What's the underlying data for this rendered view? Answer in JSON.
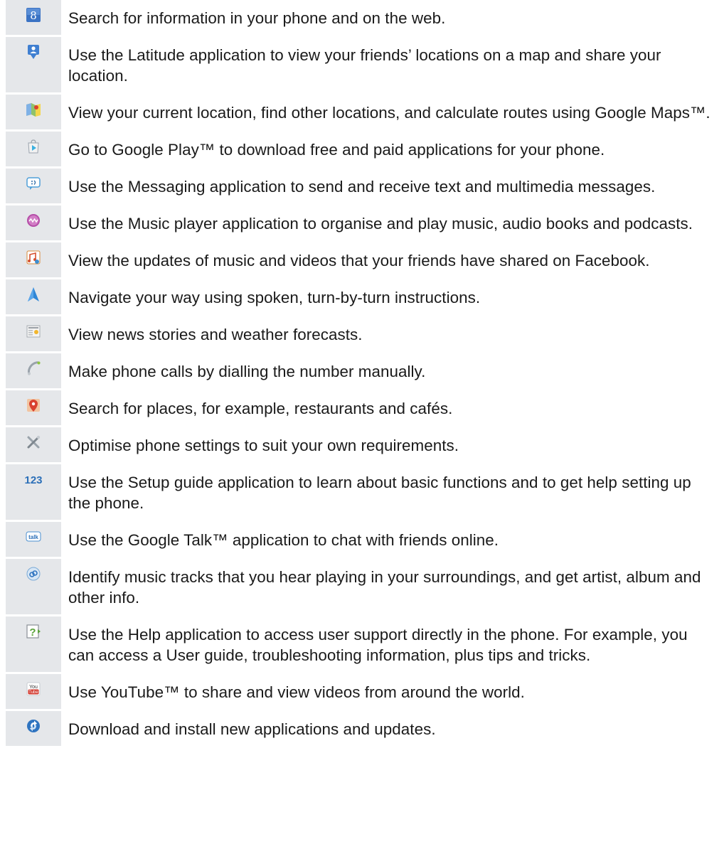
{
  "apps": [
    {
      "icon": "google-search-icon",
      "text": "Search for information in your phone and on the web."
    },
    {
      "icon": "latitude-icon",
      "text": "Use the Latitude application to view your friends’ locations on a map and share your location."
    },
    {
      "icon": "maps-icon",
      "text": "View your current location, find other locations, and calculate routes using Google Maps™."
    },
    {
      "icon": "play-store-icon",
      "text": "Go to Google Play™ to download free and paid applications for your phone."
    },
    {
      "icon": "messaging-icon",
      "text": "Use the Messaging application to send and receive text and multimedia messages."
    },
    {
      "icon": "music-player-icon",
      "text": "Use the Music player application to organise and play music, audio books and podcasts."
    },
    {
      "icon": "friends-music-icon",
      "text": "View the updates of music and videos that your friends have shared on Facebook."
    },
    {
      "icon": "navigation-icon",
      "text": "Navigate your way using spoken, turn-by-turn instructions."
    },
    {
      "icon": "news-weather-icon",
      "text": "View news stories and weather forecasts."
    },
    {
      "icon": "phone-icon",
      "text": "Make phone calls by dialling the number manually."
    },
    {
      "icon": "places-icon",
      "text": "Search for places, for example, restaurants and cafés."
    },
    {
      "icon": "settings-icon",
      "text": "Optimise phone settings to suit your own requirements."
    },
    {
      "icon": "setup-guide-icon",
      "text": "Use the Setup guide application to learn about basic functions and to get help setting up the phone."
    },
    {
      "icon": "talk-icon",
      "text": "Use the Google Talk™ application to chat with friends online."
    },
    {
      "icon": "trackid-icon",
      "text": "Identify music tracks that you hear playing in your surroundings, and get artist, album and other info."
    },
    {
      "icon": "help-icon",
      "text": "Use the Help application to access user support directly in the phone. For example, you can access a User guide, troubleshooting information, plus tips and tricks."
    },
    {
      "icon": "youtube-icon",
      "text": "Use YouTube™ to share and view videos from around the world."
    },
    {
      "icon": "update-center-icon",
      "text": "Download and install new applications and updates."
    }
  ],
  "icon_labels": {
    "google": "8",
    "setup": "123",
    "talk": "talk",
    "youtube_top": "You",
    "youtube_bottom": "Tube",
    "help": "?"
  }
}
